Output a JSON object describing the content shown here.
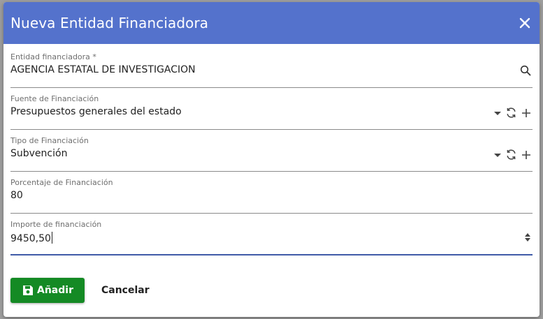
{
  "dialog": {
    "title": "Nueva Entidad Financiadora",
    "close_icon": "close-icon"
  },
  "fields": {
    "entidad": {
      "label": "Entidad financiadora *",
      "value": "AGENCIA ESTATAL DE INVESTIGACION",
      "icon": "search-icon"
    },
    "fuente": {
      "label": "Fuente de Financiación",
      "value": "Presupuestos generales del estado",
      "icons": [
        "dropdown-arrow-icon",
        "refresh-icon",
        "add-icon"
      ]
    },
    "tipo": {
      "label": "Tipo de Financiación",
      "value": "Subvención",
      "icons": [
        "dropdown-arrow-icon",
        "refresh-icon",
        "add-icon"
      ]
    },
    "porcentaje": {
      "label": "Porcentaje de Financiación",
      "value": "80"
    },
    "importe": {
      "label": "Importe de financiación",
      "value": "9450,50",
      "icon": "spinner-icon"
    }
  },
  "actions": {
    "save_label": "Añadir",
    "save_icon": "save-icon",
    "cancel_label": "Cancelar"
  },
  "colors": {
    "header": "#5472cc",
    "primary": "#148a24",
    "active_underline": "#3f5aa8"
  }
}
